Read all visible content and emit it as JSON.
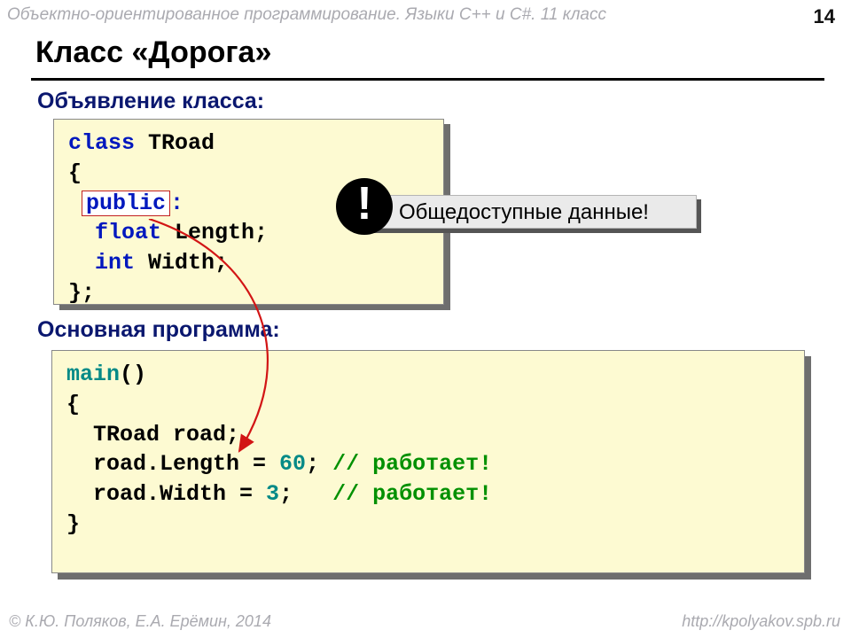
{
  "header": "Объектно-ориентированное программирование. Языки C++ и C#. 11 класс",
  "page": "14",
  "title": "Класс «Дорога»",
  "section1": "Объявление класса:",
  "section2": "Основная программа:",
  "code1": {
    "kw_class": "class",
    "cls": " TRoad",
    "brace_open": "{",
    "public_kw": "public",
    "colon": ":",
    "float_kw": "float",
    "length": " Length;",
    "int_kw": "int",
    "width": " Width;",
    "brace_close": "};"
  },
  "callout": "Общедоступные данные!",
  "bang": "!",
  "code2": {
    "main_kw": "main",
    "main_paren": "()",
    "brace_open": "{",
    "l1": "  TRoad road;",
    "l2a": "  road.Length = ",
    "l2num": "60",
    "l2b": "; ",
    "l2c": "// работает!",
    "l3a": "  road.Width = ",
    "l3num": "3",
    "l3b": ";   ",
    "l3c": "// работает!",
    "brace_close": "}"
  },
  "footer_left": "© К.Ю. Поляков, Е.А. Ерёмин, 2014",
  "footer_right": "http://kpolyakov.spb.ru"
}
